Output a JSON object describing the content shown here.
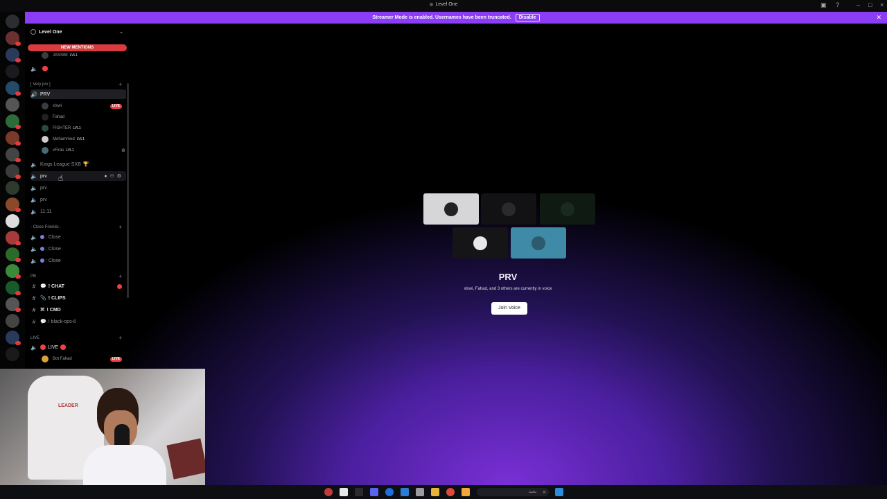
{
  "window": {
    "title": "Level One"
  },
  "banner": {
    "text": "Streamer Mode is enabled. Usernames have been truncated.",
    "disable_label": "Disable"
  },
  "server": {
    "name": "Level One",
    "new_mentions_label": "NEW MENTIONS"
  },
  "sidebar": {
    "top_user": {
      "name": "JASSIM",
      "tag": "LVL1"
    },
    "category_very_prv": "[ Very prv ]",
    "channel_prv_main": "PRV",
    "voice_users": [
      {
        "name": "xlxwi",
        "live": "LIVE"
      },
      {
        "name": "Fahad"
      },
      {
        "name": "FIGHTER",
        "tag": "LVL1"
      },
      {
        "name": "Mohammed",
        "tag": "LVL1"
      },
      {
        "name": "vFiras",
        "tag": "LVL1"
      }
    ],
    "channels_group1": [
      {
        "name": "Kings League SXB"
      },
      {
        "name": "prv"
      },
      {
        "name": "prv"
      },
      {
        "name": "prv"
      },
      {
        "name": "11:11"
      }
    ],
    "category_close_friends": "- Close Friends -",
    "close_channels": [
      {
        "name": ": Close"
      },
      {
        "name": ": Close"
      },
      {
        "name": ": Close"
      }
    ],
    "category_pb": "PB",
    "text_channels": [
      {
        "name": "! CHAT"
      },
      {
        "name": "! CLIPS"
      },
      {
        "name": "! CMD"
      },
      {
        "name": "! black-ops-6"
      }
    ],
    "category_live": "LIVE",
    "live_channel": "LIVE",
    "live_user": {
      "name": "Bot Fahad",
      "live": "LIVE"
    }
  },
  "voice": {
    "channel_name": "PRV",
    "subtitle": "xlxwi, Fahad, and 3 others are currently in voice",
    "join_label": "Join Voice"
  },
  "webcam": {
    "chair_brand": "LEADER"
  },
  "taskbar": {
    "search_placeholder": "بحث"
  },
  "colors": {
    "banner": "#8b3df5",
    "live": "#ed4245",
    "accent_gradient": "#7a2fd6"
  }
}
